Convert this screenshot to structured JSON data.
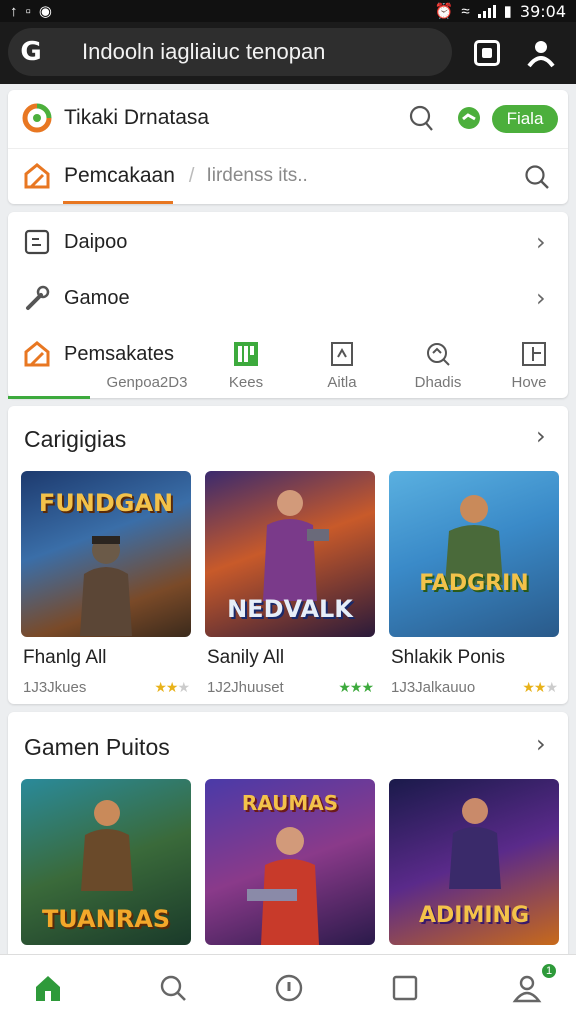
{
  "status_bar": {
    "time": "39:04"
  },
  "address_bar": {
    "url_text": "Indooln iagliaiuc tenopan"
  },
  "header": {
    "title": "Tikaki Drnatasa",
    "action_label": "Fiala",
    "search_tab_label": "Pemcakaan",
    "search_placeholder": "Iirdenss its.."
  },
  "menu": {
    "items": [
      {
        "label": "Daipoo",
        "icon": "document-icon"
      },
      {
        "label": "Gamoe",
        "icon": "wrench-icon"
      },
      {
        "label": "Pemsakates",
        "icon": "home-icon"
      }
    ],
    "categories": [
      {
        "label": "Genpoa2D3",
        "icon": "home-icon",
        "active": true
      },
      {
        "label": "Kees",
        "icon": "grid-icon"
      },
      {
        "label": "Aitla",
        "icon": "doc-icon"
      },
      {
        "label": "Dhadis",
        "icon": "search-icon"
      },
      {
        "label": "Hove",
        "icon": "flag-icon"
      }
    ]
  },
  "sections": [
    {
      "title": "Carigigias",
      "games": [
        {
          "art_title": "FUNDGAN",
          "name": "Fhanlg All",
          "downloads": "1J3Jkues",
          "rating": 2
        },
        {
          "art_title": "NEDVALK",
          "name": "Sanily All",
          "downloads": "1J2Jhuuset",
          "rating": 3
        },
        {
          "art_title": "FADGRIN",
          "name": "Shlakik Ponis",
          "downloads": "1J3Jalkauuo",
          "rating": 2
        }
      ]
    },
    {
      "title": "Gamen Puitos",
      "games": [
        {
          "art_title": "TUANRAS"
        },
        {
          "art_title": "RAUMAS"
        },
        {
          "art_title": "ADIMING"
        }
      ]
    }
  ],
  "bottom_nav": {
    "profile_badge": "1"
  },
  "colors": {
    "accent_orange": "#e87722",
    "accent_green": "#4caf3c",
    "dark_bar": "#1b1b1b"
  }
}
